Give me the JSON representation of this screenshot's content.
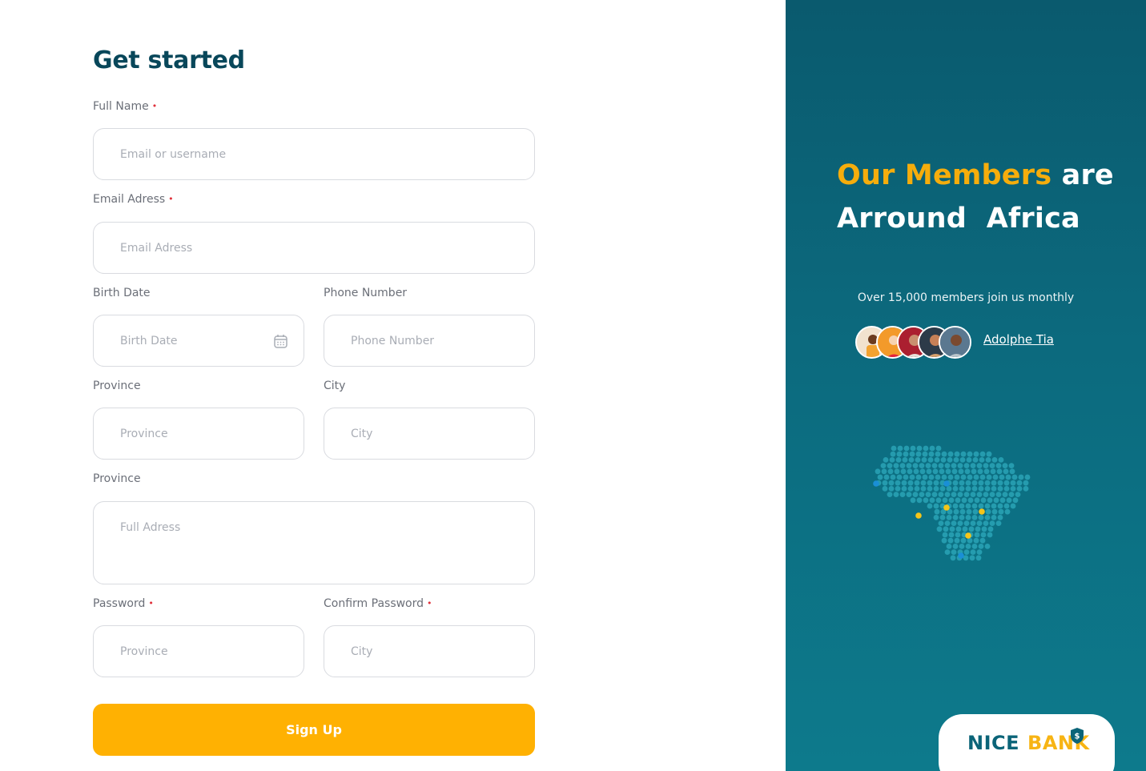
{
  "form": {
    "title": "Get started",
    "required_mark": "•",
    "full_name": {
      "label": "Full Name",
      "placeholder": "Email or username"
    },
    "email": {
      "label": "Email Adress",
      "placeholder": "Email Adress"
    },
    "birth_date": {
      "label": "Birth Date",
      "placeholder": "Birth Date",
      "icon": "calendar-icon"
    },
    "phone": {
      "label": "Phone Number",
      "placeholder": "Phone Number"
    },
    "province": {
      "label": "Province",
      "placeholder": "Province"
    },
    "city": {
      "label": "City",
      "placeholder": "City"
    },
    "address": {
      "label": "Province",
      "placeholder": "Full Adress"
    },
    "password": {
      "label": "Password",
      "placeholder": "Province"
    },
    "confirm_password": {
      "label": "Confirm Password",
      "placeholder": "City"
    },
    "submit_label": "Sign Up"
  },
  "side": {
    "headline_highlight": "Our Members",
    "headline_rest": "are",
    "headline_line2": "Arround  Africa",
    "members_text": "Over 15,000 members join us monthly",
    "member_link": "Adolphe Tia",
    "logo_part1": "NICE",
    "logo_part2": "BANK",
    "logo_badge": "$"
  },
  "colors": {
    "brand_dark": "#08475a",
    "accent": "#ffb102",
    "panel": "#0c6a7e",
    "required": "#e0313b"
  }
}
